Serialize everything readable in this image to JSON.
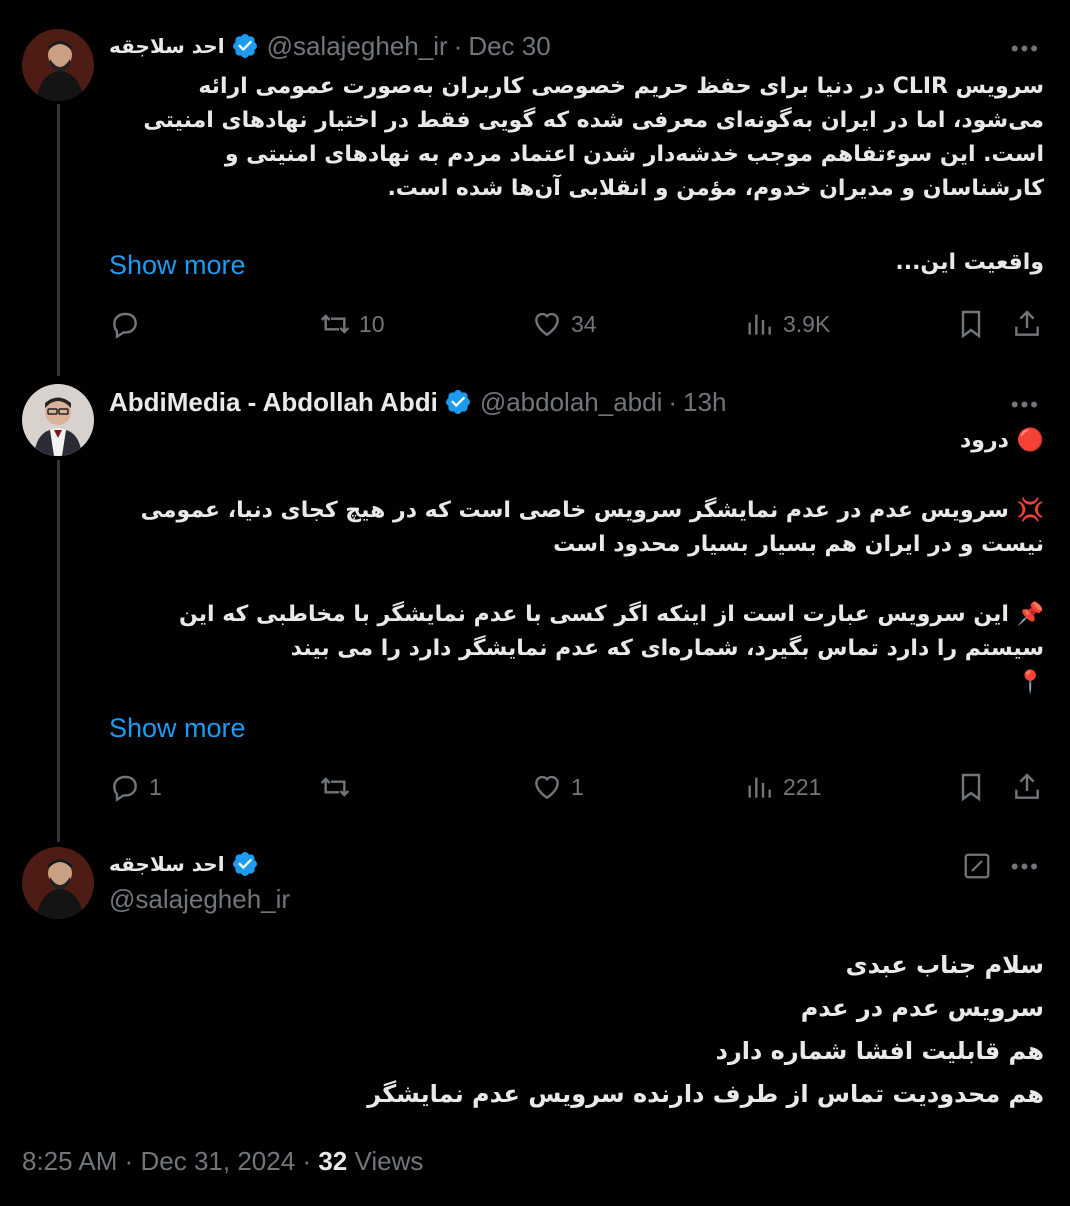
{
  "tweets": [
    {
      "name": "احد سلاجقه",
      "handle": "@salajegheh_ir",
      "time": "Dec 30",
      "paragraphs": [
        "سرویس CLIR در دنیا برای حفظ حریم خصوصی کاربران به‌صورت عمومی ارائه می‌شود، اما در ایران به‌گونه‌ای معرفی شده که گویی فقط در اختیار نهادهای امنیتی است. این سوءتفاهم موجب خدشه‌دار شدن اعتماد مردم به نهادهای امنیتی و کارشناسان و مدیران خدوم، مؤمن و انقلابی آن‌ها شده است.",
        "واقعیت این..."
      ],
      "show_more": "Show more",
      "stats": {
        "replies": "",
        "retweets": "10",
        "likes": "34",
        "views": "3.9K"
      }
    },
    {
      "name": "AbdiMedia - Abdollah Abdi",
      "handle": "@abdolah_abdi",
      "time": "13h",
      "paragraphs": [
        "🔴 درود",
        "💢 سرویس عدم در عدم نمایشگر سرویس خاصی است که در  هیچ کجای دنیا، عمومی نیست و در ایران هم بسیار بسیار محدود است",
        "📌 این سرویس عبارت است از اینکه اگر کسی با عدم نمایشگر با مخاطبی که این سیستم را دارد تماس بگیرد، شماره‌ای که عدم نمایشگر دارد را می بیند",
        "📍"
      ],
      "show_more": "Show more",
      "stats": {
        "replies": "1",
        "retweets": "",
        "likes": "1",
        "views": "221"
      }
    },
    {
      "name": "احد سلاجقه",
      "handle": "@salajegheh_ir",
      "lines": [
        "سلام جناب عبدی",
        "سرویس عدم در عدم",
        "هم قابلیت افشا شماره دارد",
        "هم محدودیت تماس از طرف دارنده سرویس عدم نمایشگر"
      ],
      "timestamp": "8:25 AM · Dec 31, 2024",
      "views_count": "32",
      "views_label": "Views"
    }
  ],
  "separator": "·",
  "more_glyph": "•••",
  "colors": {
    "background": "#000000",
    "text": "#e7e9ea",
    "muted": "#71767b",
    "link": "#1d9bf0",
    "verified": "#1d9bf0"
  },
  "icons": [
    "verified-badge-icon",
    "reply-icon",
    "retweet-icon",
    "like-icon",
    "views-icon",
    "bookmark-icon",
    "share-icon",
    "edit-icon",
    "more-icon"
  ]
}
